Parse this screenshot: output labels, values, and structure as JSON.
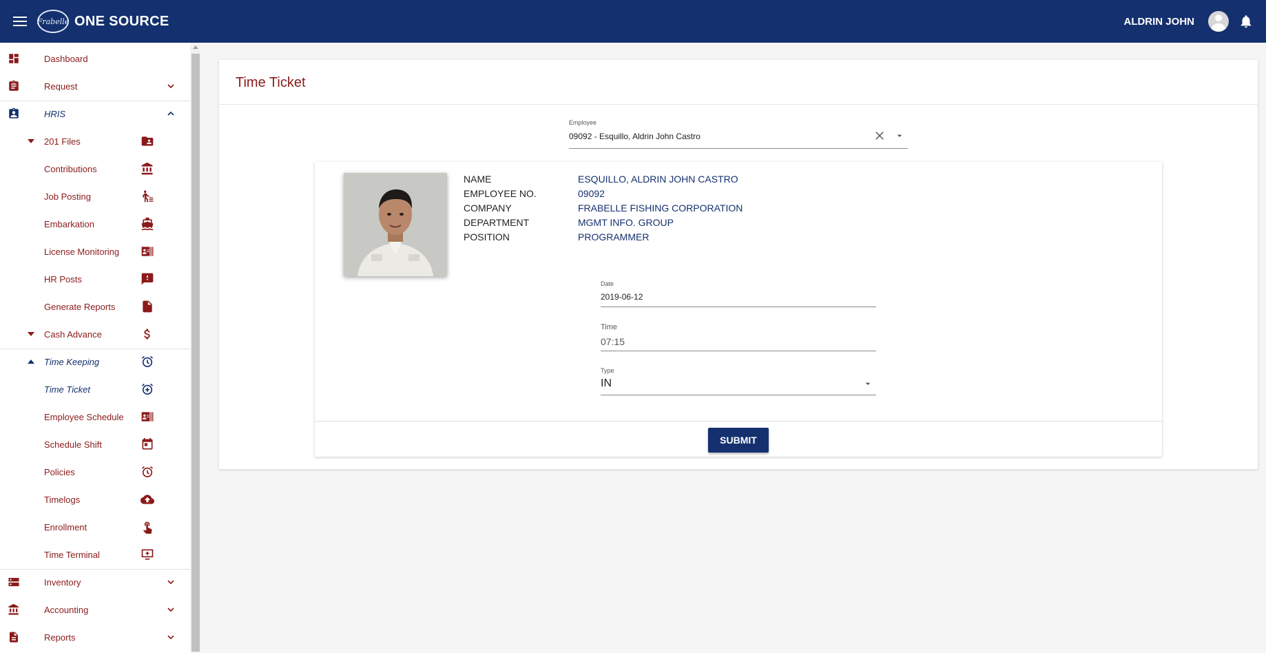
{
  "topbar": {
    "logo_text": "Frabelle",
    "brand": "ONE SOURCE",
    "username": "ALDRIN JOHN"
  },
  "sidebar": {
    "items": [
      {
        "label": "Dashboard",
        "icon": "dashboard-icon"
      },
      {
        "label": "Request",
        "icon": "clipboard-icon"
      },
      {
        "label": "HRIS",
        "icon": "badge-icon"
      },
      {
        "label": "201 Files",
        "icon": "folder-account-icon"
      },
      {
        "label": "Contributions",
        "icon": "bank-icon"
      },
      {
        "label": "Job Posting",
        "icon": "walking-list-icon"
      },
      {
        "label": "Embarkation",
        "icon": "ship-icon"
      },
      {
        "label": "License Monitoring",
        "icon": "id-card-icon"
      },
      {
        "label": "HR Posts",
        "icon": "alert-message-icon"
      },
      {
        "label": "Generate Reports",
        "icon": "document-icon"
      },
      {
        "label": "Cash Advance",
        "icon": "dollar-icon"
      },
      {
        "label": "Time Keeping",
        "icon": "alarm-icon"
      },
      {
        "label": "Time Ticket",
        "icon": "alarm-plus-icon"
      },
      {
        "label": "Employee Schedule",
        "icon": "id-card-icon"
      },
      {
        "label": "Schedule Shift",
        "icon": "calendar-icon"
      },
      {
        "label": "Policies",
        "icon": "alarm-icon"
      },
      {
        "label": "Timelogs",
        "icon": "cloud-upload-icon"
      },
      {
        "label": "Enrollment",
        "icon": "touch-icon"
      },
      {
        "label": "Time Terminal",
        "icon": "monitor-plus-icon"
      },
      {
        "label": "Inventory",
        "icon": "server-icon"
      },
      {
        "label": "Accounting",
        "icon": "bank-icon"
      },
      {
        "label": "Reports",
        "icon": "document-icon"
      }
    ]
  },
  "main": {
    "title": "Time Ticket",
    "employee": {
      "label": "Employee",
      "value": "09092 - Esquillo, Aldrin John Castro"
    },
    "profile": {
      "keys": [
        "NAME",
        "EMPLOYEE NO.",
        "COMPANY",
        "DEPARTMENT",
        "POSITION"
      ],
      "values": [
        "ESQUILLO, ALDRIN JOHN CASTRO",
        "09092",
        "FRABELLE FISHING CORPORATION",
        "MGMT INFO. GROUP",
        "PROGRAMMER"
      ]
    },
    "date": {
      "label": "Date",
      "value": "2019-06-12"
    },
    "time": {
      "label": "Time",
      "value": "07:15"
    },
    "type": {
      "label": "Type",
      "value": "IN"
    },
    "submit_label": "SUBMIT"
  },
  "colors": {
    "primary": "#14306e",
    "accent": "#8b1a1a"
  }
}
